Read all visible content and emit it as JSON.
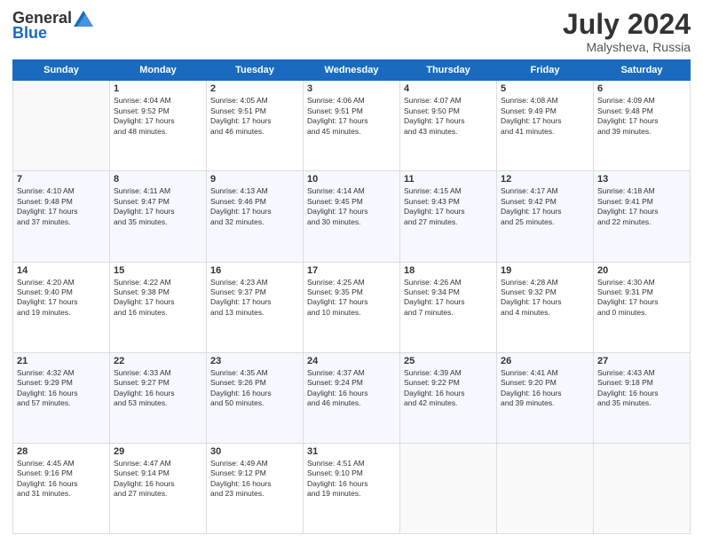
{
  "header": {
    "logo_general": "General",
    "logo_blue": "Blue",
    "month_year": "July 2024",
    "location": "Malysheva, Russia"
  },
  "days_of_week": [
    "Sunday",
    "Monday",
    "Tuesday",
    "Wednesday",
    "Thursday",
    "Friday",
    "Saturday"
  ],
  "weeks": [
    [
      {
        "day": "",
        "info": ""
      },
      {
        "day": "1",
        "info": "Sunrise: 4:04 AM\nSunset: 9:52 PM\nDaylight: 17 hours\nand 48 minutes."
      },
      {
        "day": "2",
        "info": "Sunrise: 4:05 AM\nSunset: 9:51 PM\nDaylight: 17 hours\nand 46 minutes."
      },
      {
        "day": "3",
        "info": "Sunrise: 4:06 AM\nSunset: 9:51 PM\nDaylight: 17 hours\nand 45 minutes."
      },
      {
        "day": "4",
        "info": "Sunrise: 4:07 AM\nSunset: 9:50 PM\nDaylight: 17 hours\nand 43 minutes."
      },
      {
        "day": "5",
        "info": "Sunrise: 4:08 AM\nSunset: 9:49 PM\nDaylight: 17 hours\nand 41 minutes."
      },
      {
        "day": "6",
        "info": "Sunrise: 4:09 AM\nSunset: 9:48 PM\nDaylight: 17 hours\nand 39 minutes."
      }
    ],
    [
      {
        "day": "7",
        "info": "Sunrise: 4:10 AM\nSunset: 9:48 PM\nDaylight: 17 hours\nand 37 minutes."
      },
      {
        "day": "8",
        "info": "Sunrise: 4:11 AM\nSunset: 9:47 PM\nDaylight: 17 hours\nand 35 minutes."
      },
      {
        "day": "9",
        "info": "Sunrise: 4:13 AM\nSunset: 9:46 PM\nDaylight: 17 hours\nand 32 minutes."
      },
      {
        "day": "10",
        "info": "Sunrise: 4:14 AM\nSunset: 9:45 PM\nDaylight: 17 hours\nand 30 minutes."
      },
      {
        "day": "11",
        "info": "Sunrise: 4:15 AM\nSunset: 9:43 PM\nDaylight: 17 hours\nand 27 minutes."
      },
      {
        "day": "12",
        "info": "Sunrise: 4:17 AM\nSunset: 9:42 PM\nDaylight: 17 hours\nand 25 minutes."
      },
      {
        "day": "13",
        "info": "Sunrise: 4:18 AM\nSunset: 9:41 PM\nDaylight: 17 hours\nand 22 minutes."
      }
    ],
    [
      {
        "day": "14",
        "info": "Sunrise: 4:20 AM\nSunset: 9:40 PM\nDaylight: 17 hours\nand 19 minutes."
      },
      {
        "day": "15",
        "info": "Sunrise: 4:22 AM\nSunset: 9:38 PM\nDaylight: 17 hours\nand 16 minutes."
      },
      {
        "day": "16",
        "info": "Sunrise: 4:23 AM\nSunset: 9:37 PM\nDaylight: 17 hours\nand 13 minutes."
      },
      {
        "day": "17",
        "info": "Sunrise: 4:25 AM\nSunset: 9:35 PM\nDaylight: 17 hours\nand 10 minutes."
      },
      {
        "day": "18",
        "info": "Sunrise: 4:26 AM\nSunset: 9:34 PM\nDaylight: 17 hours\nand 7 minutes."
      },
      {
        "day": "19",
        "info": "Sunrise: 4:28 AM\nSunset: 9:32 PM\nDaylight: 17 hours\nand 4 minutes."
      },
      {
        "day": "20",
        "info": "Sunrise: 4:30 AM\nSunset: 9:31 PM\nDaylight: 17 hours\nand 0 minutes."
      }
    ],
    [
      {
        "day": "21",
        "info": "Sunrise: 4:32 AM\nSunset: 9:29 PM\nDaylight: 16 hours\nand 57 minutes."
      },
      {
        "day": "22",
        "info": "Sunrise: 4:33 AM\nSunset: 9:27 PM\nDaylight: 16 hours\nand 53 minutes."
      },
      {
        "day": "23",
        "info": "Sunrise: 4:35 AM\nSunset: 9:26 PM\nDaylight: 16 hours\nand 50 minutes."
      },
      {
        "day": "24",
        "info": "Sunrise: 4:37 AM\nSunset: 9:24 PM\nDaylight: 16 hours\nand 46 minutes."
      },
      {
        "day": "25",
        "info": "Sunrise: 4:39 AM\nSunset: 9:22 PM\nDaylight: 16 hours\nand 42 minutes."
      },
      {
        "day": "26",
        "info": "Sunrise: 4:41 AM\nSunset: 9:20 PM\nDaylight: 16 hours\nand 39 minutes."
      },
      {
        "day": "27",
        "info": "Sunrise: 4:43 AM\nSunset: 9:18 PM\nDaylight: 16 hours\nand 35 minutes."
      }
    ],
    [
      {
        "day": "28",
        "info": "Sunrise: 4:45 AM\nSunset: 9:16 PM\nDaylight: 16 hours\nand 31 minutes."
      },
      {
        "day": "29",
        "info": "Sunrise: 4:47 AM\nSunset: 9:14 PM\nDaylight: 16 hours\nand 27 minutes."
      },
      {
        "day": "30",
        "info": "Sunrise: 4:49 AM\nSunset: 9:12 PM\nDaylight: 16 hours\nand 23 minutes."
      },
      {
        "day": "31",
        "info": "Sunrise: 4:51 AM\nSunset: 9:10 PM\nDaylight: 16 hours\nand 19 minutes."
      },
      {
        "day": "",
        "info": ""
      },
      {
        "day": "",
        "info": ""
      },
      {
        "day": "",
        "info": ""
      }
    ]
  ]
}
